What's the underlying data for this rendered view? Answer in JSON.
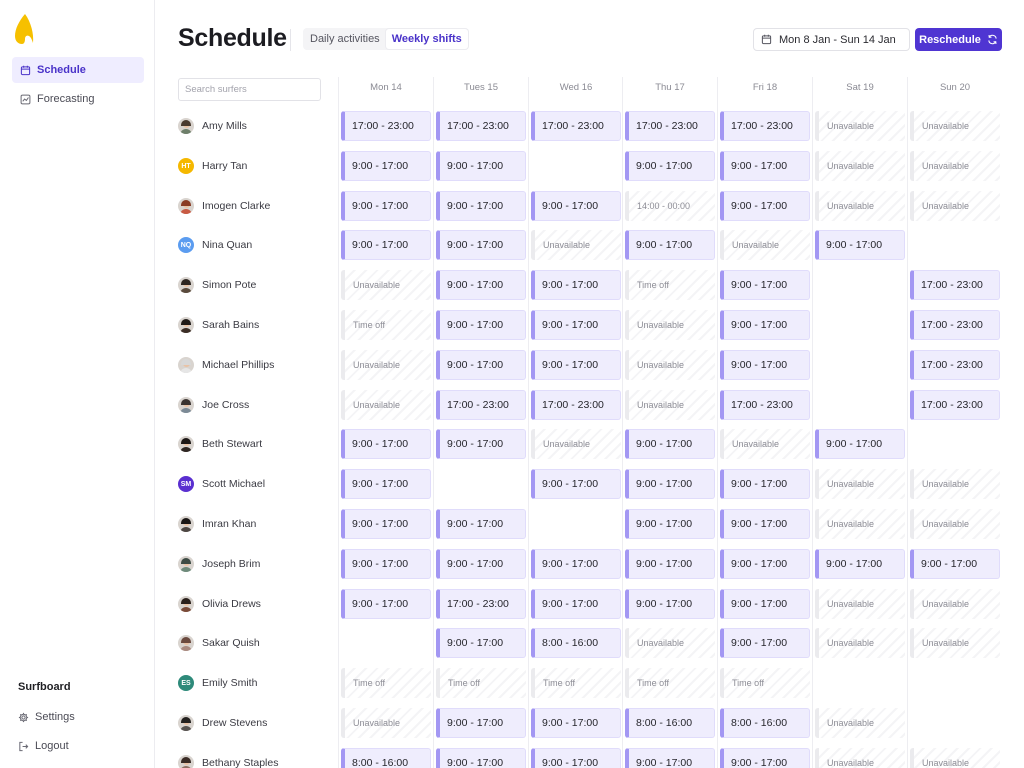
{
  "nav": {
    "items": [
      {
        "label": "Schedule",
        "icon": "calendar-icon",
        "active": true
      },
      {
        "label": "Forecasting",
        "icon": "chart-icon",
        "active": false
      }
    ]
  },
  "sidebar_bottom": {
    "org_name": "Surfboard",
    "settings_label": "Settings",
    "logout_label": "Logout"
  },
  "header": {
    "title": "Schedule",
    "view_tabs": [
      {
        "label": "Daily activities",
        "active": false
      },
      {
        "label": "Weekly shifts",
        "active": true
      }
    ],
    "date_range": "Mon 8 Jan - Sun 14 Jan",
    "reschedule_label": "Reschedule"
  },
  "search": {
    "placeholder": "Search surfers"
  },
  "colors": {
    "accent": "#4f35d2",
    "shift_bg": "#efedfd",
    "shift_bar": "#a397f3"
  },
  "days": [
    "Mon 14",
    "Tues 15",
    "Wed 16",
    "Thu 17",
    "Fri 18",
    "Sat 19",
    "Sun 20"
  ],
  "people": [
    {
      "name": "Amy Mills",
      "avatar": {
        "type": "photo",
        "hair": "#4a3a2e",
        "body": "#6e7f6a"
      },
      "cells": [
        {
          "s": "shift",
          "t": "17:00 - 23:00"
        },
        {
          "s": "shift",
          "t": "17:00 - 23:00"
        },
        {
          "s": "shift",
          "t": "17:00 - 23:00"
        },
        {
          "s": "shift",
          "t": "17:00 - 23:00"
        },
        {
          "s": "shift",
          "t": "17:00 - 23:00"
        },
        {
          "s": "off",
          "t": "Unavailable"
        },
        {
          "s": "off",
          "t": "Unavailable"
        }
      ]
    },
    {
      "name": "Harry Tan",
      "avatar": {
        "type": "initials",
        "text": "HT",
        "color": "#f5b800"
      },
      "cells": [
        {
          "s": "shift",
          "t": "9:00 - 17:00"
        },
        {
          "s": "shift",
          "t": "9:00 - 17:00"
        },
        null,
        {
          "s": "shift",
          "t": "9:00 - 17:00"
        },
        {
          "s": "shift",
          "t": "9:00 - 17:00"
        },
        {
          "s": "off",
          "t": "Unavailable"
        },
        {
          "s": "off",
          "t": "Unavailable"
        }
      ]
    },
    {
      "name": "Imogen Clarke",
      "avatar": {
        "type": "photo",
        "hair": "#8a3b24",
        "body": "#c85a43"
      },
      "cells": [
        {
          "s": "shift",
          "t": "9:00 - 17:00"
        },
        {
          "s": "shift",
          "t": "9:00 - 17:00"
        },
        {
          "s": "shift",
          "t": "9:00 - 17:00"
        },
        {
          "s": "off",
          "t": "14:00 - 00:00"
        },
        {
          "s": "shift",
          "t": "9:00 - 17:00"
        },
        {
          "s": "off",
          "t": "Unavailable"
        },
        {
          "s": "off",
          "t": "Unavailable"
        }
      ]
    },
    {
      "name": "Nina Quan",
      "avatar": {
        "type": "initials",
        "text": "NQ",
        "color": "#5b9cf0"
      },
      "cells": [
        {
          "s": "shift",
          "t": "9:00 - 17:00"
        },
        {
          "s": "shift",
          "t": "9:00 - 17:00"
        },
        {
          "s": "off",
          "t": "Unavailable"
        },
        {
          "s": "shift",
          "t": "9:00 - 17:00"
        },
        {
          "s": "off",
          "t": "Unavailable"
        },
        {
          "s": "shift",
          "t": "9:00 - 17:00"
        },
        null
      ]
    },
    {
      "name": "Simon Pote",
      "avatar": {
        "type": "photo",
        "hair": "#2d2520",
        "body": "#5a4a3c"
      },
      "cells": [
        {
          "s": "off",
          "t": "Unavailable"
        },
        {
          "s": "shift",
          "t": "9:00 - 17:00"
        },
        {
          "s": "shift",
          "t": "9:00 - 17:00"
        },
        {
          "s": "off",
          "t": "Time off"
        },
        {
          "s": "shift",
          "t": "9:00 - 17:00"
        },
        null,
        {
          "s": "shift",
          "t": "17:00 - 23:00"
        }
      ]
    },
    {
      "name": "Sarah Bains",
      "avatar": {
        "type": "photo",
        "hair": "#1f1a17",
        "body": "#3b2d25"
      },
      "cells": [
        {
          "s": "off",
          "t": "Time off"
        },
        {
          "s": "shift",
          "t": "9:00 - 17:00"
        },
        {
          "s": "shift",
          "t": "9:00 - 17:00"
        },
        {
          "s": "off",
          "t": "Unavailable"
        },
        {
          "s": "shift",
          "t": "9:00 - 17:00"
        },
        null,
        {
          "s": "shift",
          "t": "17:00 - 23:00"
        }
      ]
    },
    {
      "name": "Michael Phillips",
      "avatar": {
        "type": "photo",
        "hair": "#d8d8d8",
        "body": "#e6e6e6"
      },
      "cells": [
        {
          "s": "off",
          "t": "Unavailable"
        },
        {
          "s": "shift",
          "t": "9:00 - 17:00"
        },
        {
          "s": "shift",
          "t": "9:00 - 17:00"
        },
        {
          "s": "off",
          "t": "Unavailable"
        },
        {
          "s": "shift",
          "t": "9:00 - 17:00"
        },
        null,
        {
          "s": "shift",
          "t": "17:00 - 23:00"
        }
      ]
    },
    {
      "name": "Joe Cross",
      "avatar": {
        "type": "photo",
        "hair": "#3a3330",
        "body": "#7c8a96"
      },
      "cells": [
        {
          "s": "off",
          "t": "Unavailable"
        },
        {
          "s": "shift",
          "t": "17:00 - 23:00"
        },
        {
          "s": "shift",
          "t": "17:00 - 23:00"
        },
        {
          "s": "off",
          "t": "Unavailable"
        },
        {
          "s": "shift",
          "t": "17:00 - 23:00"
        },
        null,
        {
          "s": "shift",
          "t": "17:00 - 23:00"
        }
      ]
    },
    {
      "name": "Beth Stewart",
      "avatar": {
        "type": "photo",
        "hair": "#1c1715",
        "body": "#2e2622"
      },
      "cells": [
        {
          "s": "shift",
          "t": "9:00 - 17:00"
        },
        {
          "s": "shift",
          "t": "9:00 - 17:00"
        },
        {
          "s": "off",
          "t": "Unavailable"
        },
        {
          "s": "shift",
          "t": "9:00 - 17:00"
        },
        {
          "s": "off",
          "t": "Unavailable"
        },
        {
          "s": "shift",
          "t": "9:00 - 17:00"
        },
        null
      ]
    },
    {
      "name": "Scott Michael",
      "avatar": {
        "type": "initials",
        "text": "SM",
        "color": "#5a2fd0"
      },
      "cells": [
        {
          "s": "shift",
          "t": "9:00 - 17:00"
        },
        null,
        {
          "s": "shift",
          "t": "9:00 - 17:00"
        },
        {
          "s": "shift",
          "t": "9:00 - 17:00"
        },
        {
          "s": "shift",
          "t": "9:00 - 17:00"
        },
        {
          "s": "off",
          "t": "Unavailable"
        },
        {
          "s": "off",
          "t": "Unavailable"
        }
      ]
    },
    {
      "name": "Imran Khan",
      "avatar": {
        "type": "photo",
        "hair": "#1a1614",
        "body": "#4d4642"
      },
      "cells": [
        {
          "s": "shift",
          "t": "9:00 - 17:00"
        },
        {
          "s": "shift",
          "t": "9:00 - 17:00"
        },
        null,
        {
          "s": "shift",
          "t": "9:00 - 17:00"
        },
        {
          "s": "shift",
          "t": "9:00 - 17:00"
        },
        {
          "s": "off",
          "t": "Unavailable"
        },
        {
          "s": "off",
          "t": "Unavailable"
        }
      ]
    },
    {
      "name": "Joseph Brim",
      "avatar": {
        "type": "photo",
        "hair": "#3d4b44",
        "body": "#6e8a7b"
      },
      "cells": [
        {
          "s": "shift",
          "t": "9:00 - 17:00"
        },
        {
          "s": "shift",
          "t": "9:00 - 17:00"
        },
        {
          "s": "shift",
          "t": "9:00 - 17:00"
        },
        {
          "s": "shift",
          "t": "9:00 - 17:00"
        },
        {
          "s": "shift",
          "t": "9:00 - 17:00"
        },
        {
          "s": "shift",
          "t": "9:00 - 17:00"
        },
        {
          "s": "shift",
          "t": "9:00 - 17:00"
        }
      ]
    },
    {
      "name": "Olivia Drews",
      "avatar": {
        "type": "photo",
        "hair": "#2a1f1a",
        "body": "#7a4a38"
      },
      "cells": [
        {
          "s": "shift",
          "t": "9:00 - 17:00"
        },
        {
          "s": "shift",
          "t": "17:00 - 23:00"
        },
        {
          "s": "shift",
          "t": "9:00 - 17:00"
        },
        {
          "s": "shift",
          "t": "9:00 - 17:00"
        },
        {
          "s": "shift",
          "t": "9:00 - 17:00"
        },
        {
          "s": "off",
          "t": "Unavailable"
        },
        {
          "s": "off",
          "t": "Unavailable"
        }
      ]
    },
    {
      "name": "Sakar Quish",
      "avatar": {
        "type": "photo",
        "hair": "#6b4a3f",
        "body": "#a98a80"
      },
      "cells": [
        null,
        {
          "s": "shift",
          "t": "9:00 - 17:00"
        },
        {
          "s": "shift",
          "t": "8:00 - 16:00"
        },
        {
          "s": "off",
          "t": "Unavailable"
        },
        {
          "s": "shift",
          "t": "9:00 - 17:00"
        },
        {
          "s": "off",
          "t": "Unavailable"
        },
        {
          "s": "off",
          "t": "Unavailable"
        }
      ]
    },
    {
      "name": "Emily Smith",
      "avatar": {
        "type": "initials",
        "text": "ES",
        "color": "#2e8a7a"
      },
      "cells": [
        {
          "s": "off",
          "t": "Time off"
        },
        {
          "s": "off",
          "t": "Time off"
        },
        {
          "s": "off",
          "t": "Time off"
        },
        {
          "s": "off",
          "t": "Time off"
        },
        {
          "s": "off",
          "t": "Time off"
        },
        null,
        null
      ]
    },
    {
      "name": "Drew Stevens",
      "avatar": {
        "type": "photo",
        "hair": "#24211f",
        "body": "#575350"
      },
      "cells": [
        {
          "s": "off",
          "t": "Unavailable"
        },
        {
          "s": "shift",
          "t": "9:00 - 17:00"
        },
        {
          "s": "shift",
          "t": "9:00 - 17:00"
        },
        {
          "s": "shift",
          "t": "8:00 - 16:00"
        },
        {
          "s": "shift",
          "t": "8:00 - 16:00"
        },
        {
          "s": "off",
          "t": "Unavailable"
        },
        null
      ]
    },
    {
      "name": "Bethany Staples",
      "avatar": {
        "type": "photo",
        "hair": "#3a2c26",
        "body": "#8e6f63"
      },
      "cells": [
        {
          "s": "shift",
          "t": "8:00 - 16:00"
        },
        {
          "s": "shift",
          "t": "9:00 - 17:00"
        },
        {
          "s": "shift",
          "t": "9:00 - 17:00"
        },
        {
          "s": "shift",
          "t": "9:00 - 17:00"
        },
        {
          "s": "shift",
          "t": "9:00 - 17:00"
        },
        {
          "s": "off",
          "t": "Unavailable"
        },
        {
          "s": "off",
          "t": "Unavailable"
        }
      ]
    }
  ]
}
